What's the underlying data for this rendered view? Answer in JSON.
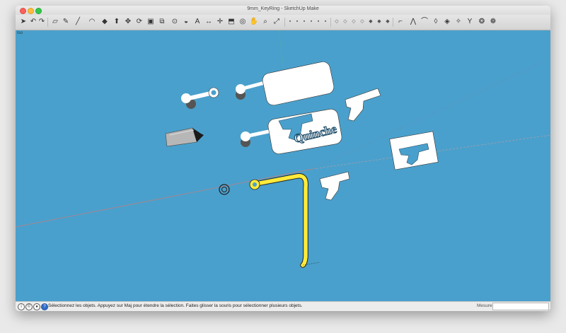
{
  "window": {
    "title": "9mm_KeyRing - SketchUp Make"
  },
  "viewport": {
    "scene_label": "Iso",
    "background": "#4aa0cc"
  },
  "model": {
    "text_3d": "Quinche",
    "selection_color": "#ffeb3b"
  },
  "toolbar": {
    "icons": [
      "select-arrow-icon",
      "undo-icon",
      "redo-icon",
      "eraser-icon",
      "pencil-icon",
      "line-tool-icon",
      "arc-icon",
      "paint-bucket-icon",
      "push-pull-icon",
      "move-icon",
      "rotate-icon",
      "scale-icon",
      "offset-icon",
      "tape-measure-icon",
      "protractor-icon",
      "text-icon",
      "dimension-icon",
      "axes-icon",
      "section-plane-icon",
      "orbit-icon",
      "pan-icon",
      "zoom-icon",
      "zoom-extents-icon",
      "components-icon",
      "warehouse-icon",
      "extension-icon"
    ]
  },
  "status": {
    "message": "Sélectionnez les objets. Appuyez sur Maj pour étendre la sélection. Faites glisser la souris pour sélectionner plusieurs objets.",
    "measures_label": "Mesures"
  }
}
